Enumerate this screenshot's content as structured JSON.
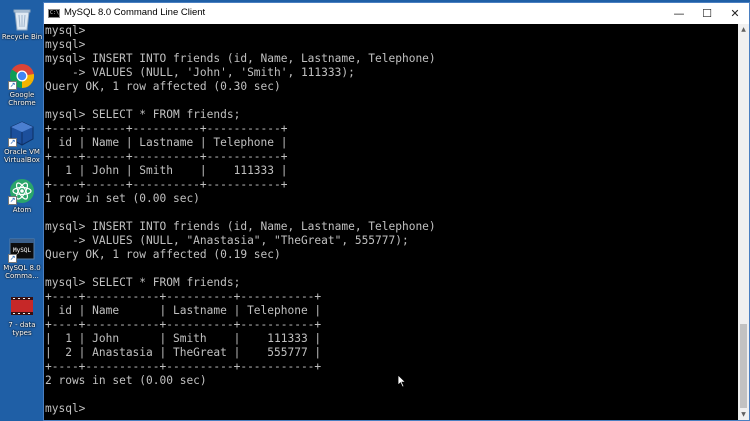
{
  "window": {
    "title": "MySQL 8.0 Command Line Client",
    "app_icon_text": "C:\\",
    "minimize_glyph": "—",
    "maximize_glyph": "☐",
    "close_glyph": "✕"
  },
  "desktop": {
    "icons": [
      {
        "name": "recycle-bin",
        "label": "Recycle Bin",
        "icon": "recycle-bin-icon"
      },
      {
        "name": "google-chrome",
        "label": "Google\nChrome",
        "icon": "chrome-icon"
      },
      {
        "name": "oracle-vm-virtualbox",
        "label": "Oracle VM\nVirtualBox",
        "icon": "virtualbox-icon"
      },
      {
        "name": "atom",
        "label": "Atom",
        "icon": "atom-icon"
      },
      {
        "name": "mysql-command-line",
        "label": "MySQL 8.0\nComma...",
        "icon": "mysql-icon"
      },
      {
        "name": "data-types-video",
        "label": "7 - data types",
        "icon": "video-file-icon"
      }
    ]
  },
  "console": {
    "lines": [
      "mysql>",
      "mysql>",
      "mysql> INSERT INTO friends (id, Name, Lastname, Telephone)",
      "    -> VALUES (NULL, 'John', 'Smith', 111333);",
      "Query OK, 1 row affected (0.30 sec)",
      "",
      "mysql> SELECT * FROM friends;",
      "+----+------+----------+-----------+",
      "| id | Name | Lastname | Telephone |",
      "+----+------+----------+-----------+",
      "|  1 | John | Smith    |    111333 |",
      "+----+------+----------+-----------+",
      "1 row in set (0.00 sec)",
      "",
      "mysql> INSERT INTO friends (id, Name, Lastname, Telephone)",
      "    -> VALUES (NULL, \"Anastasia\", \"TheGreat\", 555777);",
      "Query OK, 1 row affected (0.19 sec)",
      "",
      "mysql> SELECT * FROM friends;",
      "+----+-----------+----------+-----------+",
      "| id | Name      | Lastname | Telephone |",
      "+----+-----------+----------+-----------+",
      "|  1 | John      | Smith    |    111333 |",
      "|  2 | Anastasia | TheGreat |    555777 |",
      "+----+-----------+----------+-----------+",
      "2 rows in set (0.00 sec)",
      "",
      "mysql>"
    ]
  },
  "colors": {
    "desktop_bg": "#1f5fa6",
    "console_bg": "#000000",
    "console_fg": "#c0c0c0",
    "titlebar_bg": "#ffffff"
  }
}
